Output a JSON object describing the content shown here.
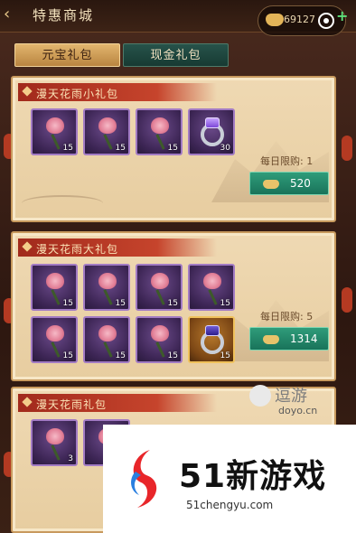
{
  "topbar": {
    "title": "特惠商城",
    "currency_value": "69127",
    "back_icon": "chevron-left-icon",
    "currency_icon": "ingot-icon",
    "menu_icon": "target-icon",
    "plus_icon": "plus-icon"
  },
  "tabs": [
    {
      "label": "元宝礼包",
      "active": true
    },
    {
      "label": "现金礼包",
      "active": false
    }
  ],
  "packs": [
    {
      "title": "漫天花雨小礼包",
      "items": [
        {
          "icon": "rose-icon",
          "count": "15"
        },
        {
          "icon": "rose-icon",
          "count": "15"
        },
        {
          "icon": "rose-icon",
          "count": "15"
        },
        {
          "icon": "ring-icon",
          "count": "30"
        }
      ],
      "limit_label": "每日限购: 1",
      "price": "520"
    },
    {
      "title": "漫天花雨大礼包",
      "items": [
        {
          "icon": "rose-icon",
          "count": "15"
        },
        {
          "icon": "rose-icon",
          "count": "15"
        },
        {
          "icon": "rose-icon",
          "count": "15"
        },
        {
          "icon": "rose-icon",
          "count": "15"
        },
        {
          "icon": "rose-icon",
          "count": "15"
        },
        {
          "icon": "rose-icon",
          "count": "15"
        },
        {
          "icon": "rose-icon",
          "count": "15"
        },
        {
          "icon": "ring-icon",
          "count": "15"
        }
      ],
      "limit_label": "每日限购: 5",
      "price": "1314"
    },
    {
      "title": "漫天花雨礼包",
      "items": [
        {
          "icon": "rose-icon",
          "count": "3"
        }
      ]
    }
  ],
  "watermarks": {
    "doyo_title": "逗游",
    "doyo_url": "doyo.cn",
    "site_title": "51新游戏",
    "site_url": "51chengyu.com"
  },
  "colors": {
    "accent_red": "#c6442c",
    "buy_green": "#19735a",
    "slot_purple": "#3c2554",
    "parchment": "#efd9b3"
  }
}
